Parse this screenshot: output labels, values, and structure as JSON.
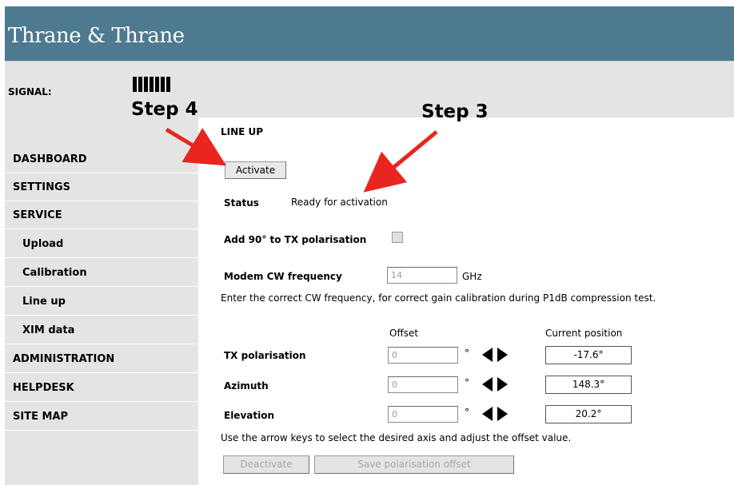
{
  "header": {
    "logo_text": "Thrane & Thrane",
    "bg_color": "#4d7991"
  },
  "signal": {
    "label": "SIGNAL:",
    "bars": 7
  },
  "sidebar": {
    "items": [
      {
        "label": "DASHBOARD"
      },
      {
        "label": "SETTINGS"
      },
      {
        "label": "SERVICE"
      },
      {
        "label": "Upload"
      },
      {
        "label": "Calibration"
      },
      {
        "label": "Line up"
      },
      {
        "label": "XIM data"
      },
      {
        "label": "ADMINISTRATION"
      },
      {
        "label": "HELPDESK"
      },
      {
        "label": "SITE MAP"
      }
    ]
  },
  "main": {
    "title": "LINE UP",
    "activate_label": "Activate",
    "status_label": "Status",
    "status_value": "Ready for activation",
    "polarisation_label": "Add 90° to TX polarisation",
    "modem_label": "Modem CW frequency",
    "modem_value": "14",
    "modem_unit": "GHz",
    "modem_help": "Enter the correct CW frequency, for correct gain calibration during P1dB compression test.",
    "offset_header": "Offset",
    "position_header": "Current position",
    "degree_symbol": "°",
    "axes": [
      {
        "label": "TX polarisation",
        "offset": "0",
        "position": "-17.6°"
      },
      {
        "label": "Azimuth",
        "offset": "0",
        "position": "148.3°"
      },
      {
        "label": "Elevation",
        "offset": "0",
        "position": "20.2°"
      }
    ],
    "arrow_help": "Use the arrow keys to select the desired axis and adjust the offset value.",
    "deactivate_label": "Deactivate",
    "save_label": "Save polarisation offset"
  },
  "annotations": {
    "step3": "Step 3",
    "step4": "Step 4",
    "arrow_color": "#e8251f"
  }
}
